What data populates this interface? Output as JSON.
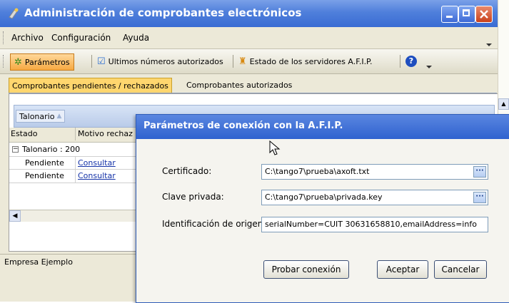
{
  "window": {
    "title": "Administración de comprobantes electrónicos",
    "colors": {
      "titlebar": "#4f7fdb",
      "accent_tab": "#ffd66e",
      "link": "#1533a8"
    }
  },
  "menu": {
    "items": [
      {
        "label": "Archivo"
      },
      {
        "label": "Configuración"
      },
      {
        "label": "Ayuda"
      }
    ]
  },
  "toolbar": {
    "parametros_label": "Parámetros",
    "ultimos_label": "Ultimos números autorizados",
    "estado_label": "Estado de los servidores A.F.I.P.",
    "help_icon": "help-icon"
  },
  "tabs": [
    {
      "label": "Comprobantes pendientes / rechazados",
      "selected": true
    },
    {
      "label": "Comprobantes autorizados",
      "selected": false
    }
  ],
  "grid": {
    "group_button": "Talonario",
    "group_sort_arrow": "▲",
    "columns": [
      "Estado",
      "Motivo rechaz"
    ],
    "group_row": "Talonario : 200",
    "rows": [
      {
        "estado": "Pendiente",
        "accion": "Consultar"
      },
      {
        "estado": "Pendiente",
        "accion": "Consultar"
      }
    ]
  },
  "status": {
    "company": "Empresa Ejemplo"
  },
  "dialog": {
    "title": "Parámetros de conexión con la A.F.I.P.",
    "fields": {
      "certificado": {
        "label": "Certificado:",
        "value": "C:\\tango7\\prueba\\axoft.txt"
      },
      "clave": {
        "label": "Clave privada:",
        "value": "C:\\tango7\\prueba\\privada.key"
      },
      "identificacion": {
        "label": "Identificación de origen:",
        "value": "serialNumber=CUIT 30631658810,emailAddress=info"
      }
    },
    "buttons": {
      "probar": "Probar conexión",
      "aceptar": "Aceptar",
      "cancelar": "Cancelar"
    },
    "browse_glyph": "···"
  }
}
